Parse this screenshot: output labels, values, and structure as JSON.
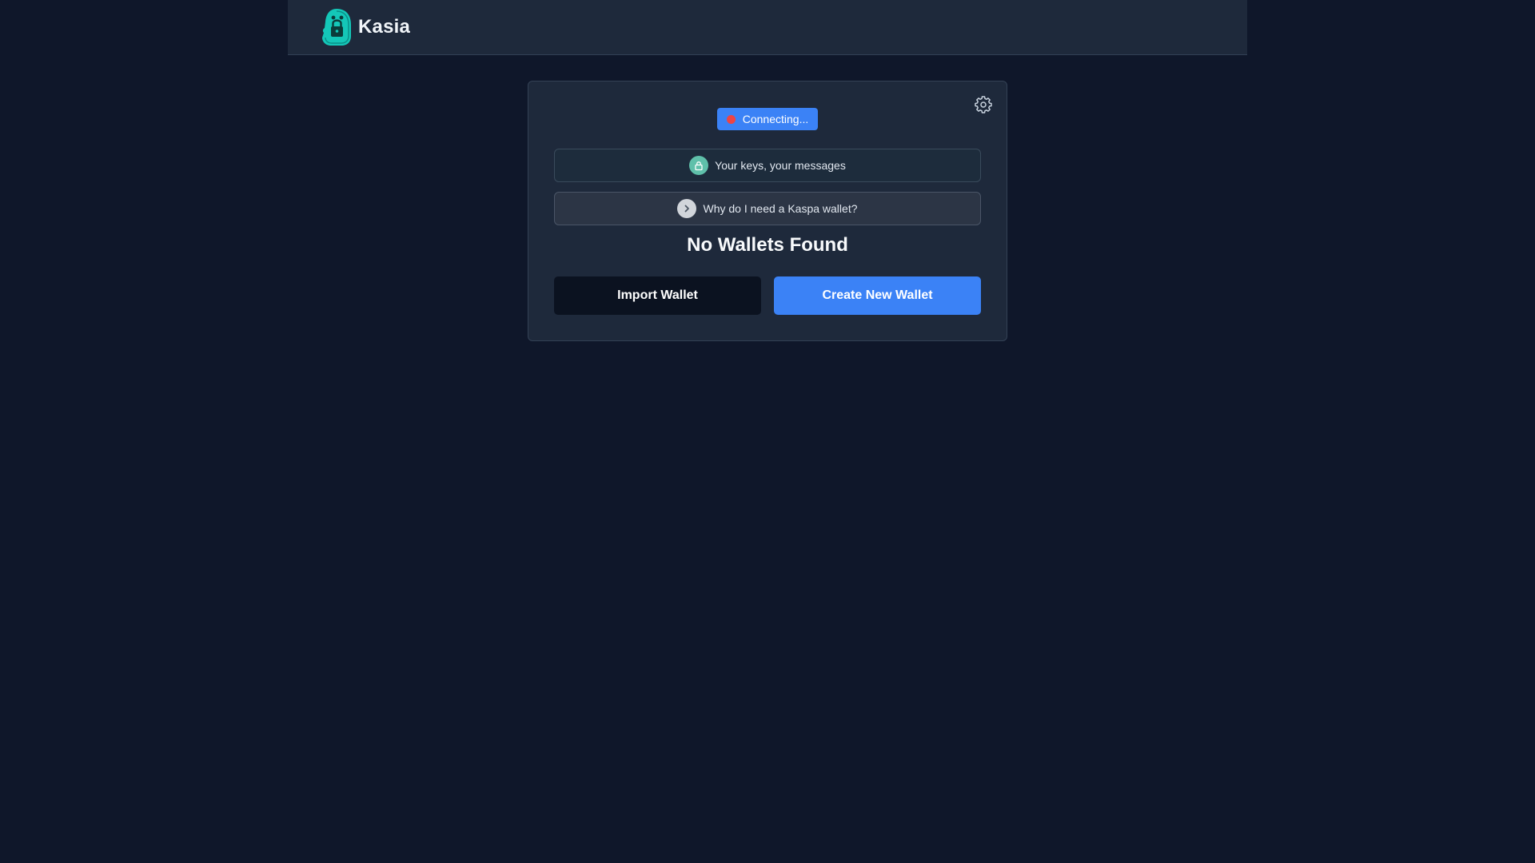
{
  "header": {
    "app_name": "Kasia",
    "logo_icon": "ghost-lock-logo"
  },
  "card": {
    "settings_icon": "gear-icon",
    "status": {
      "label": "Connecting...",
      "dot_color": "#ef4444",
      "badge_color": "#3b82f6"
    },
    "info_items": [
      {
        "label": "Your keys, your messages",
        "icon": "lock-icon"
      },
      {
        "label": "Why do I need a Kaspa wallet?",
        "icon": "chevron-right-icon"
      }
    ],
    "heading": "No Wallets Found",
    "buttons": {
      "import_label": "Import Wallet",
      "create_label": "Create New Wallet"
    }
  },
  "colors": {
    "background": "#0f172a",
    "surface": "#1e293b",
    "accent": "#3b82f6",
    "logo_teal": "#14c7b8"
  }
}
